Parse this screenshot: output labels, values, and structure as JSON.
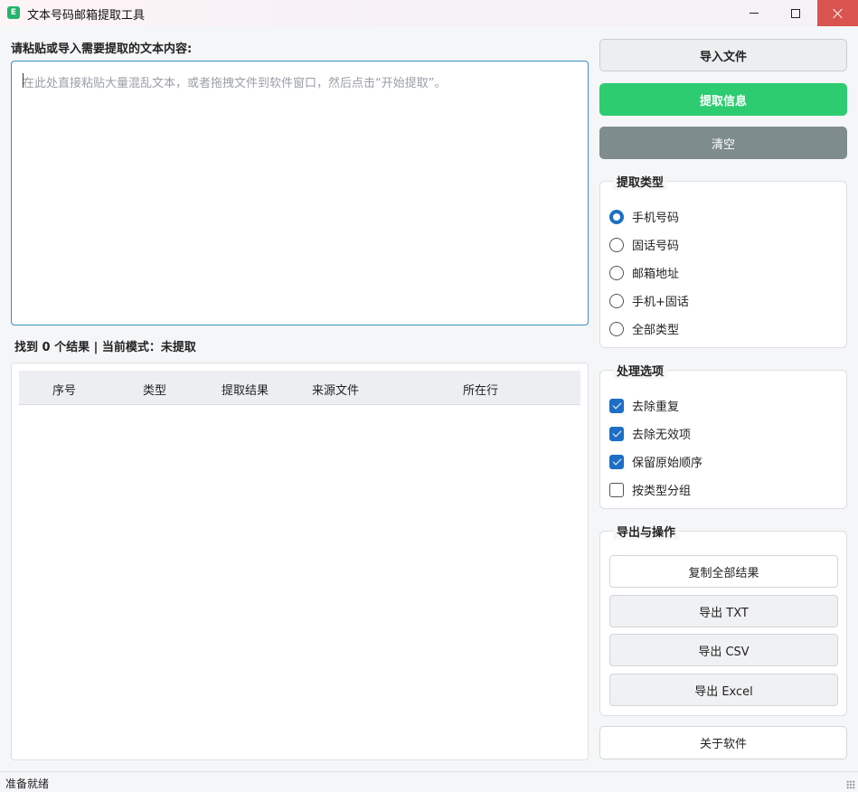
{
  "window": {
    "title": "文本号码邮箱提取工具",
    "app_icon_glyph": "E"
  },
  "input": {
    "label": "请粘贴或导入需要提取的文本内容:",
    "placeholder": "在此处直接粘贴大量混乱文本，或者拖拽文件到软件窗口，然后点击“开始提取”。"
  },
  "results": {
    "summary": "找到 0 个结果 | 当前模式：未提取",
    "columns": [
      "序号",
      "类型",
      "提取结果",
      "来源文件",
      "所在行"
    ],
    "rows": []
  },
  "actions": {
    "import_label": "导入文件",
    "extract_label": "提取信息",
    "clear_label": "清空",
    "extract_color": "#2ecc71",
    "clear_color": "#7f8c8d"
  },
  "extract_type": {
    "title": "提取类型",
    "options": [
      {
        "label": "手机号码",
        "selected": true
      },
      {
        "label": "固话号码",
        "selected": false
      },
      {
        "label": "邮箱地址",
        "selected": false
      },
      {
        "label": "手机+固话",
        "selected": false
      },
      {
        "label": "全部类型",
        "selected": false
      }
    ]
  },
  "process_options": {
    "title": "处理选项",
    "options": [
      {
        "label": "去除重复",
        "checked": true
      },
      {
        "label": "去除无效项",
        "checked": true
      },
      {
        "label": "保留原始顺序",
        "checked": true
      },
      {
        "label": "按类型分组",
        "checked": false
      }
    ]
  },
  "export": {
    "title": "导出与操作",
    "copy_all_label": "复制全部结果",
    "txt_label": "导出 TXT",
    "csv_label": "导出 CSV",
    "excel_label": "导出 Excel"
  },
  "about_label": "关于软件",
  "status": {
    "text": "准备就绪"
  },
  "accent_color": "#1c6fc4"
}
